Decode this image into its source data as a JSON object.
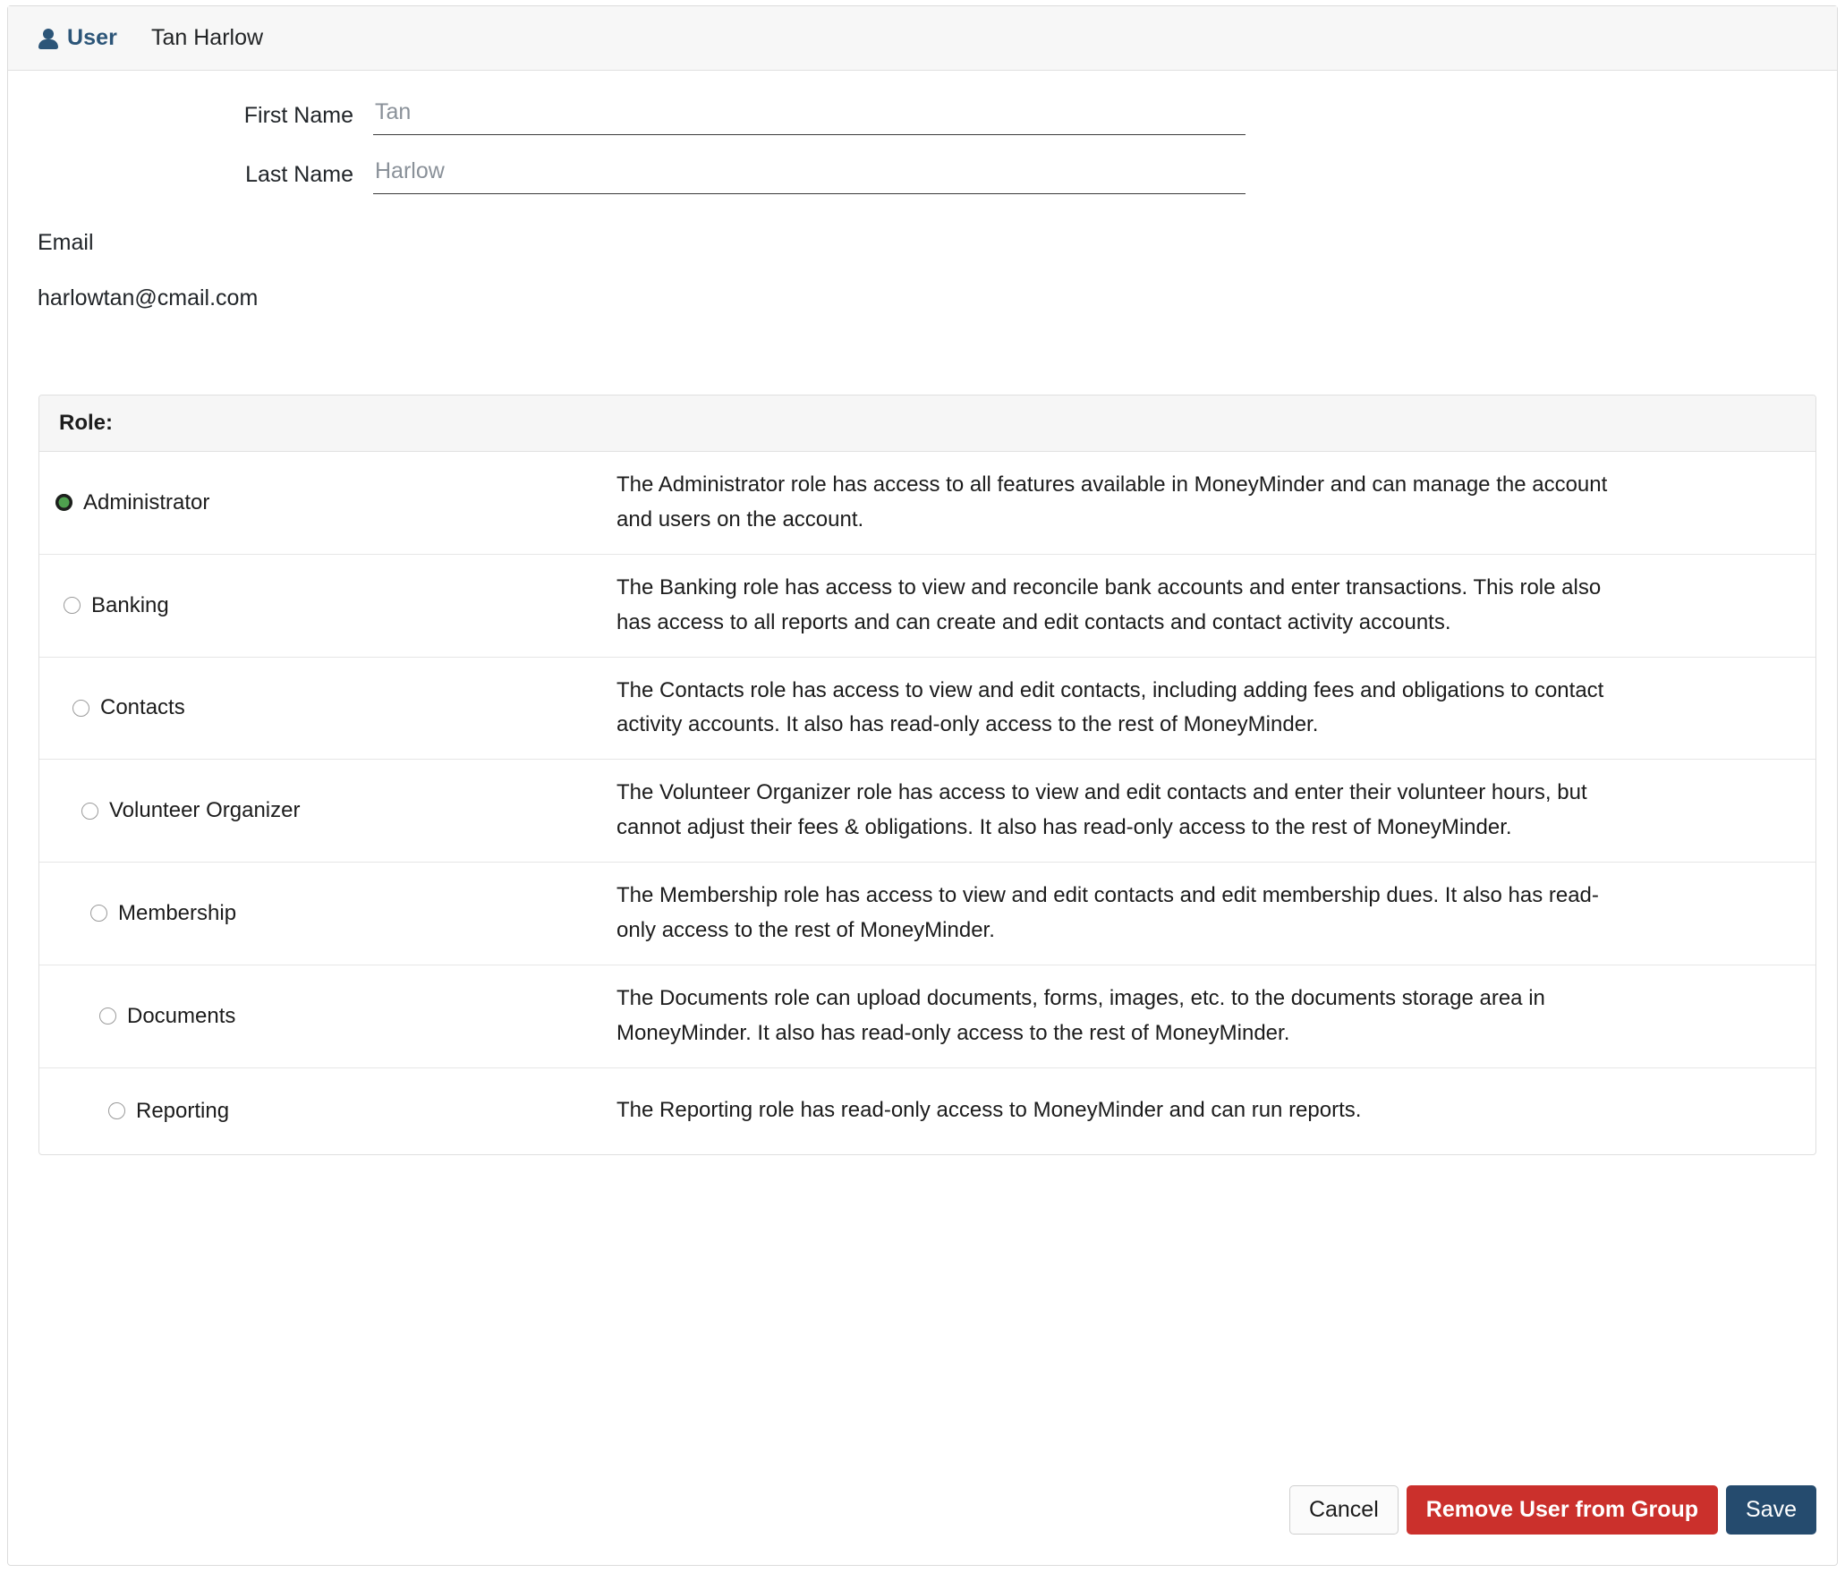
{
  "header": {
    "icon": "user-icon",
    "label": "User",
    "name": "Tan Harlow"
  },
  "form": {
    "first_name": {
      "label": "First Name",
      "value": "Tan",
      "placeholder": "Tan"
    },
    "last_name": {
      "label": "Last Name",
      "value": "Harlow",
      "placeholder": "Harlow"
    },
    "email": {
      "label": "Email",
      "value": "harlowtan@cmail.com"
    }
  },
  "role_panel": {
    "title": "Role:",
    "selected": "Administrator",
    "roles": [
      {
        "name": "Administrator",
        "selected": true,
        "description": "The Administrator role has access to all features available in MoneyMinder and can manage the account and users on the account."
      },
      {
        "name": "Banking",
        "selected": false,
        "description": "The Banking role has access to view and reconcile bank accounts and enter transactions. This role also has access to all reports and can create and edit contacts and contact activity accounts."
      },
      {
        "name": "Contacts",
        "selected": false,
        "description": "The Contacts role has access to view and edit contacts, including adding fees and obligations to contact activity accounts. It also has read-only access to the rest of MoneyMinder."
      },
      {
        "name": "Volunteer Organizer",
        "selected": false,
        "description": "The Volunteer Organizer role has access to view and edit contacts and enter their volunteer hours, but cannot adjust their fees & obligations. It also has read-only access to the rest of MoneyMinder."
      },
      {
        "name": "Membership",
        "selected": false,
        "description": "The Membership role has access to view and edit contacts and edit membership dues. It also has read-only access to the rest of MoneyMinder."
      },
      {
        "name": "Documents",
        "selected": false,
        "description": "The Documents role can upload documents, forms, images, etc. to the documents storage area in MoneyMinder. It also has read-only access to the rest of MoneyMinder."
      },
      {
        "name": "Reporting",
        "selected": false,
        "description": "The Reporting role has read-only access to MoneyMinder and can run reports."
      }
    ]
  },
  "buttons": {
    "cancel": "Cancel",
    "remove": "Remove User from Group",
    "save": "Save"
  },
  "colors": {
    "accent_navy": "#2c5578",
    "danger_red": "#cb302c",
    "save_navy": "#254b6e",
    "radio_green": "#4fa14f"
  }
}
